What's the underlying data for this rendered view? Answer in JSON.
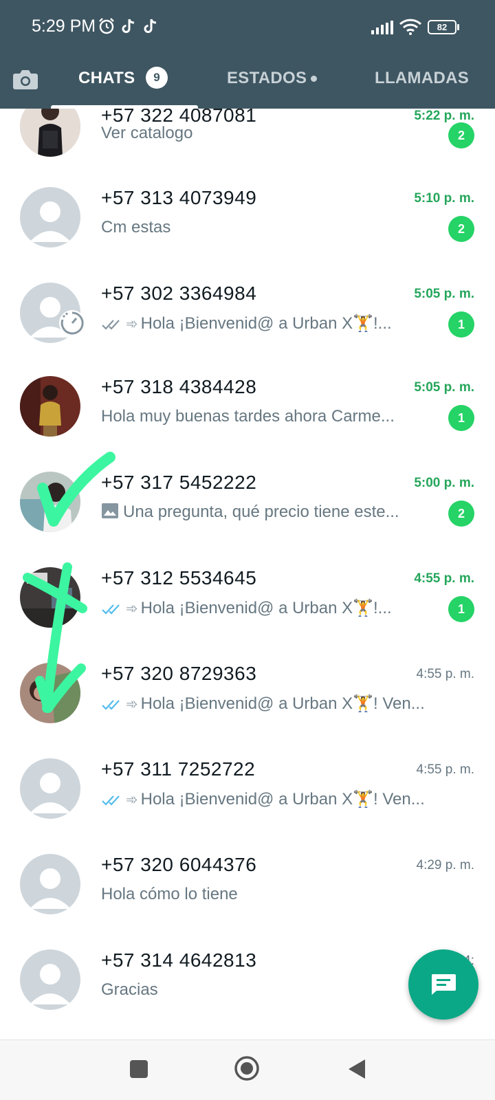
{
  "status_bar": {
    "time": "5:29 PM",
    "battery": "82",
    "icons": [
      "alarm-icon",
      "tiktok-icon",
      "tiktok-icon",
      "signal-icon",
      "wifi-icon",
      "battery-icon"
    ]
  },
  "tabs": {
    "chats_label": "CHATS",
    "chats_badge": "9",
    "estados_label": "ESTADOS",
    "llamadas_label": "LLAMADAS"
  },
  "chats": [
    {
      "name": "+57 322 4087081",
      "time": "5:22 p. m.",
      "preview": "Ver catalogo",
      "unread": "2"
    },
    {
      "name": "+57 313 4073949",
      "time": "5:10 p. m.",
      "preview": "Cm estas",
      "unread": "2"
    },
    {
      "name": "+57 302 3364984",
      "time": "5:05 p. m.",
      "preview": "Hola ¡Bienvenid@ a Urban X🏋️!...",
      "unread": "1"
    },
    {
      "name": "+57 318 4384428",
      "time": "5:05 p. m.",
      "preview": "Hola muy buenas tardes ahora Carme...",
      "unread": "1"
    },
    {
      "name": "+57 317 5452222",
      "time": "5:00 p. m.",
      "preview": "Una pregunta, qué precio tiene este...",
      "unread": "2"
    },
    {
      "name": "+57 312 5534645",
      "time": "4:55 p. m.",
      "preview": "Hola ¡Bienvenid@ a Urban X🏋️!...",
      "unread": "1"
    },
    {
      "name": "+57 320 8729363",
      "time": "4:55 p. m.",
      "preview": "Hola ¡Bienvenid@ a Urban X🏋️! Ven...",
      "unread": ""
    },
    {
      "name": "+57 311 7252722",
      "time": "4:55 p. m.",
      "preview": "Hola ¡Bienvenid@ a Urban X🏋️! Ven...",
      "unread": ""
    },
    {
      "name": "+57 320 6044376",
      "time": "4:29 p. m.",
      "preview": "Hola cómo lo tiene",
      "unread": ""
    },
    {
      "name": "+57 314 4642813",
      "time": "4:",
      "preview": "Gracias",
      "unread": ""
    }
  ],
  "colors": {
    "header": "#3e5662",
    "unread_green": "#25d366",
    "time_green": "#25a65b",
    "fab": "#0aa886",
    "marker": "#3cf5a0"
  }
}
